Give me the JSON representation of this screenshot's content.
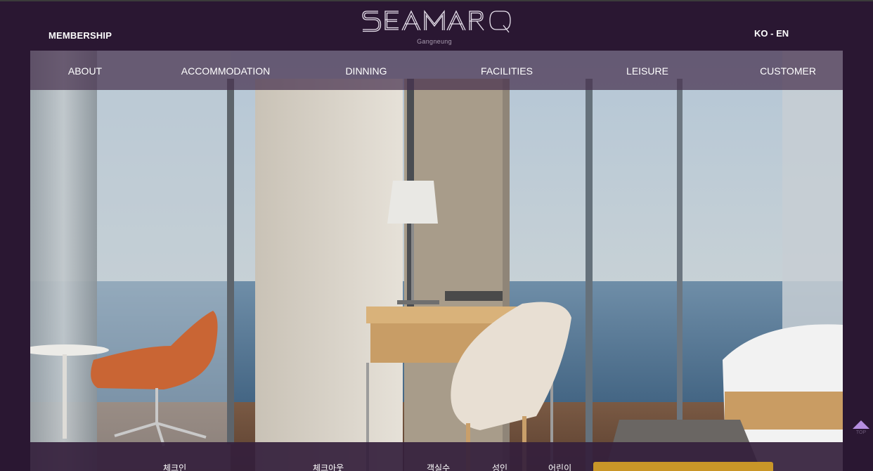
{
  "header": {
    "membership_label": "MEMBERSHIP",
    "lang": {
      "ko": "KO",
      "sep": " - ",
      "en": "EN"
    },
    "logo": {
      "wordmark": "SEAMARQ",
      "subtitle": "Gangneung"
    }
  },
  "nav": {
    "items": [
      {
        "label": "ABOUT"
      },
      {
        "label": "ACCOMMODATION"
      },
      {
        "label": "DINNING"
      },
      {
        "label": "FACILITIES"
      },
      {
        "label": "LEISURE"
      },
      {
        "label": "CUSTOMER"
      }
    ]
  },
  "booking": {
    "checkin_label": "체크인",
    "checkout_label": "체크아웃",
    "rooms_label": "객실수",
    "adults_label": "성인",
    "children_label": "어린이"
  },
  "top_button": {
    "label": "TOP"
  },
  "colors": {
    "background": "#2a1732",
    "nav_overlay": "#46304e",
    "booking_button": "#c99628",
    "top_arrow": "#b58ee0"
  }
}
